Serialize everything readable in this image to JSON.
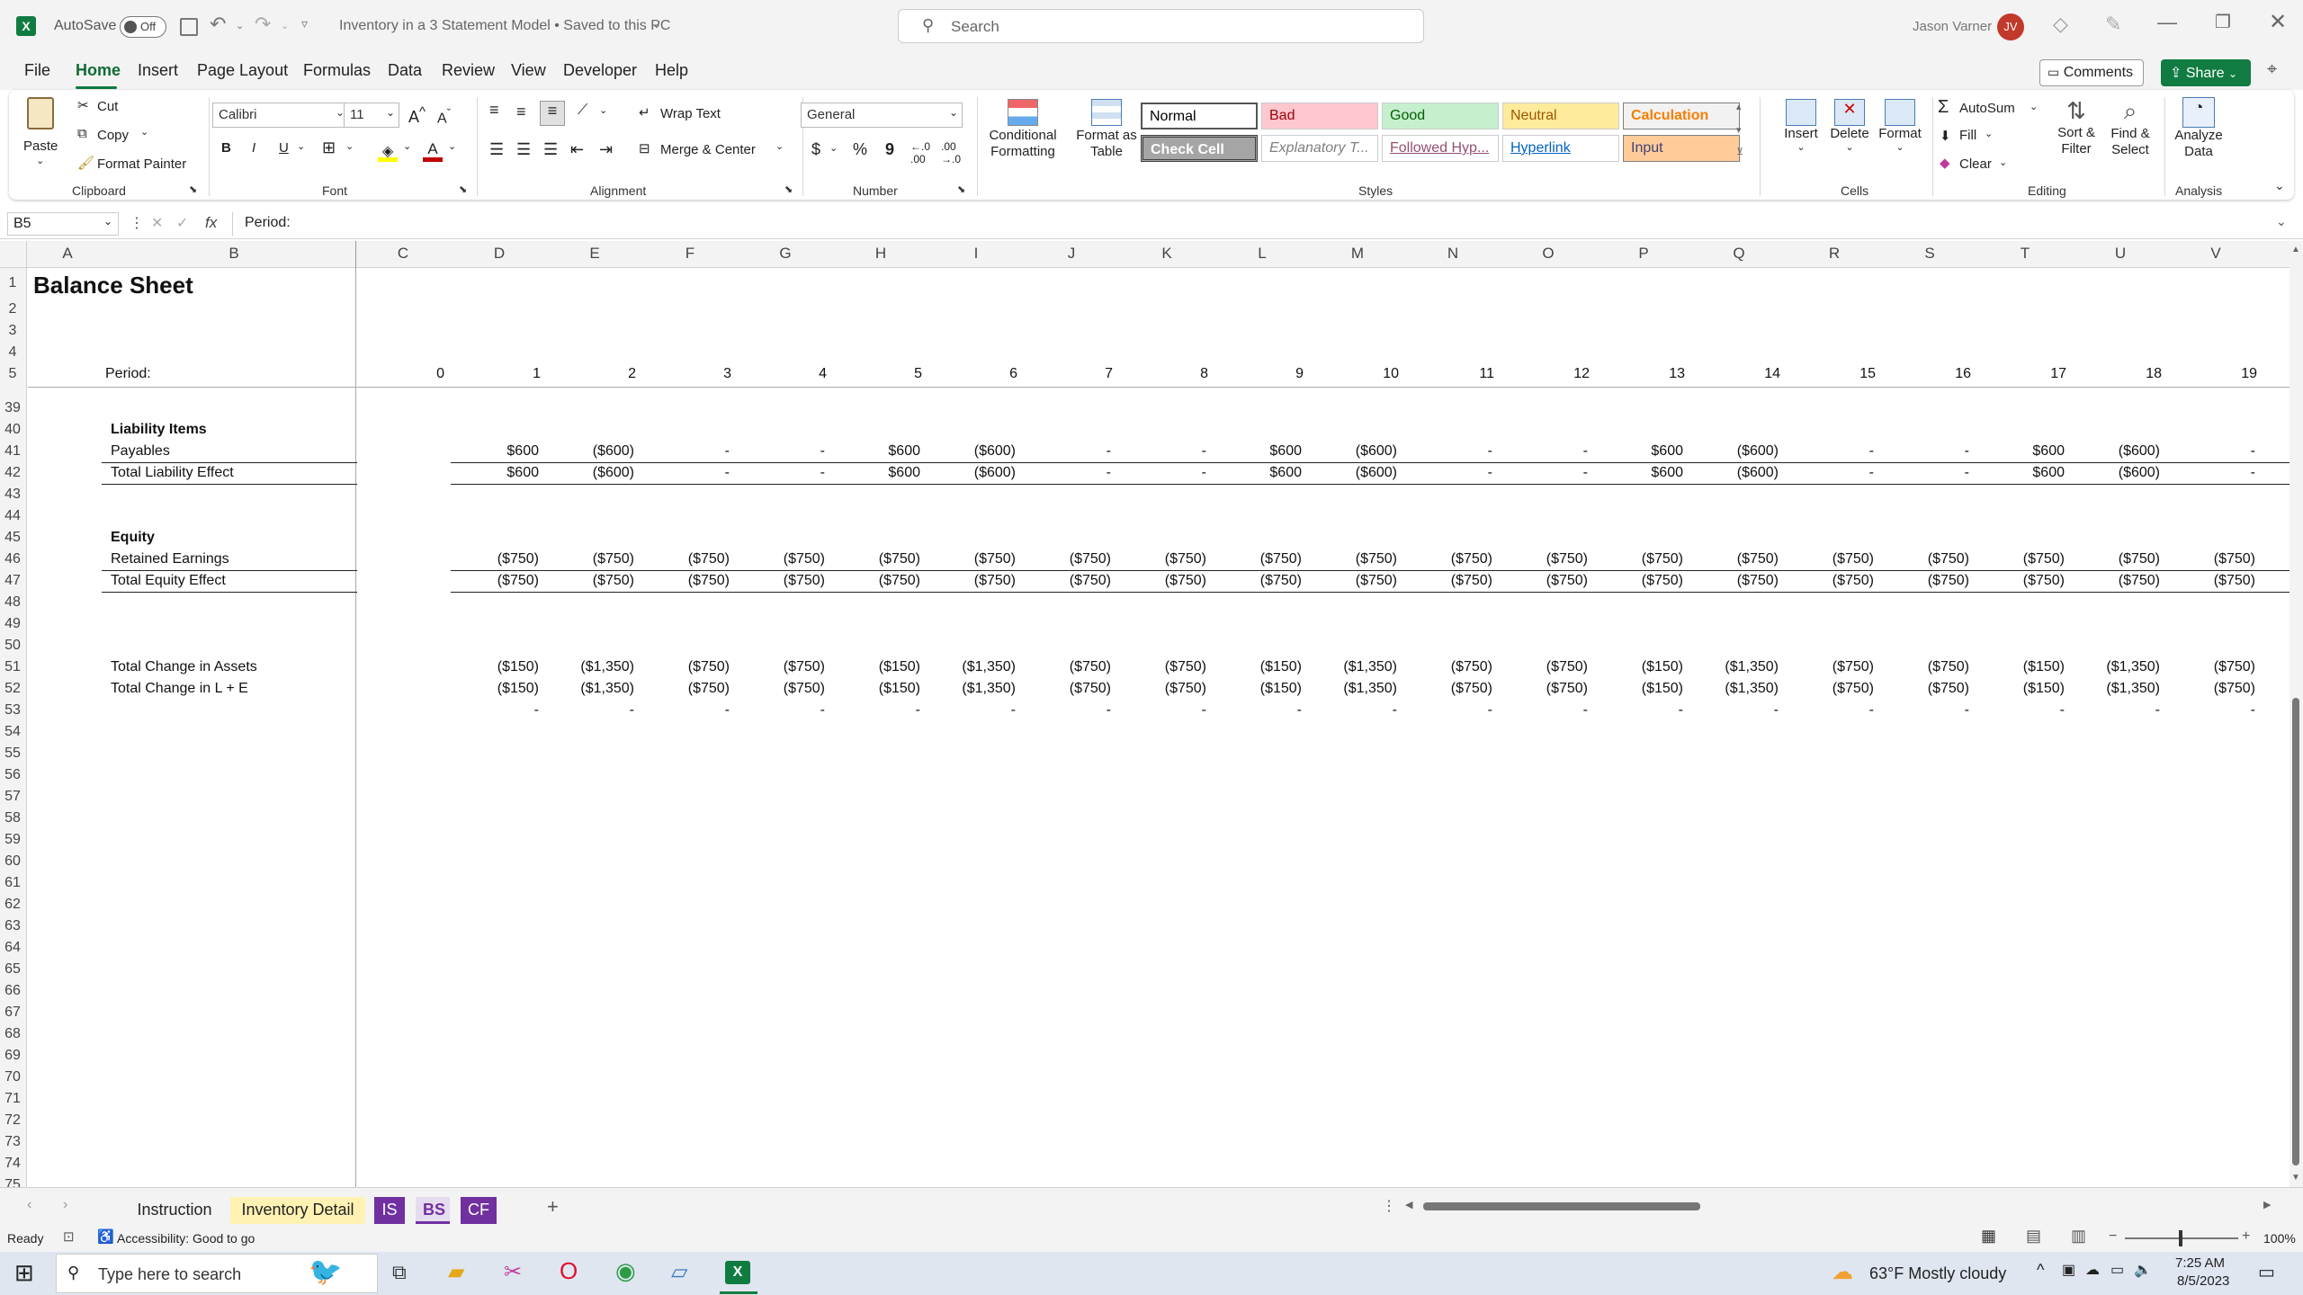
{
  "title_bar": {
    "autosave_label": "AutoSave",
    "autosave_state": "Off",
    "doc_title": "Inventory in a 3 Statement Model • Saved to this PC",
    "search_placeholder": "Search",
    "user_name": "Jason Varner",
    "user_initials": "JV"
  },
  "menu": [
    "File",
    "Home",
    "Insert",
    "Page Layout",
    "Formulas",
    "Data",
    "Review",
    "View",
    "Developer",
    "Help"
  ],
  "menu_right": {
    "comments": "Comments",
    "share": "Share"
  },
  "ribbon": {
    "clipboard": {
      "paste": "Paste",
      "cut": "Cut",
      "copy": "Copy",
      "format_painter": "Format Painter",
      "label": "Clipboard"
    },
    "font": {
      "name": "Calibri",
      "size": "11",
      "bold": "B",
      "italic": "I",
      "underline": "U",
      "label": "Font"
    },
    "alignment": {
      "wrap": "Wrap Text",
      "merge": "Merge & Center",
      "label": "Alignment"
    },
    "number": {
      "format": "General",
      "currency": "$",
      "percent": "%",
      "comma": "9",
      "label": "Number"
    },
    "styles": {
      "conditional": "Conditional Formatting",
      "format_table": "Format as Table",
      "label": "Styles",
      "cells": [
        {
          "name": "Normal",
          "bg": "#ffffff",
          "fg": "#000000"
        },
        {
          "name": "Bad",
          "bg": "#ffc7ce",
          "fg": "#9c0006"
        },
        {
          "name": "Good",
          "bg": "#c6efce",
          "fg": "#006100"
        },
        {
          "name": "Neutral",
          "bg": "#ffeb9c",
          "fg": "#9c5700"
        },
        {
          "name": "Calculation",
          "bg": "#f2f2f2",
          "fg": "#fa7d00"
        },
        {
          "name": "Check Cell",
          "bg": "#a5a5a5",
          "fg": "#ffffff"
        },
        {
          "name": "Explanatory T...",
          "bg": "#ffffff",
          "fg": "#7f7f7f"
        },
        {
          "name": "Followed Hyp...",
          "bg": "#ffffff",
          "fg": "#954f72"
        },
        {
          "name": "Hyperlink",
          "bg": "#ffffff",
          "fg": "#0563c1"
        },
        {
          "name": "Input",
          "bg": "#ffcc99",
          "fg": "#3f3f76"
        }
      ]
    },
    "cells": {
      "insert": "Insert",
      "delete": "Delete",
      "format": "Format",
      "label": "Cells"
    },
    "editing": {
      "autosum": "AutoSum",
      "fill": "Fill",
      "clear": "Clear",
      "sort": "Sort & Filter",
      "find": "Find & Select",
      "label": "Editing"
    },
    "analysis": {
      "analyze": "Analyze Data",
      "label": "Analysis"
    }
  },
  "formula_bar": {
    "name_box": "B5",
    "fx": "fx",
    "content": "Period:"
  },
  "columns": [
    "A",
    "B",
    "C",
    "D",
    "E",
    "F",
    "G",
    "H",
    "I",
    "J",
    "K",
    "L",
    "M",
    "N",
    "O",
    "P",
    "Q",
    "R",
    "S",
    "T",
    "U",
    "V"
  ],
  "rows": [
    "1",
    "2",
    "3",
    "4",
    "5",
    "39",
    "40",
    "41",
    "42",
    "43",
    "44",
    "45",
    "46",
    "47",
    "48",
    "49",
    "50",
    "51",
    "52",
    "53",
    "54",
    "55",
    "56",
    "57",
    "58",
    "59",
    "60",
    "61",
    "62",
    "63",
    "64",
    "65",
    "66",
    "67",
    "68",
    "69",
    "70",
    "71",
    "72",
    "73",
    "74",
    "75"
  ],
  "sheet": {
    "title": "Balance Sheet",
    "period_label": "Period:",
    "periods": [
      "0",
      "1",
      "2",
      "3",
      "4",
      "5",
      "6",
      "7",
      "8",
      "9",
      "10",
      "11",
      "12",
      "13",
      "14",
      "15",
      "16",
      "17",
      "18",
      "19"
    ],
    "liability_items": "Liability Items",
    "payables_label": "Payables",
    "payables": [
      "$600",
      "($600)",
      "-",
      "-",
      "$600",
      "($600)",
      "-",
      "-",
      "$600",
      "($600)",
      "-",
      "-",
      "$600",
      "($600)",
      "-",
      "-",
      "$600",
      "($600)",
      "-"
    ],
    "total_liability_label": "Total Liability Effect",
    "total_liability": [
      "$600",
      "($600)",
      "-",
      "-",
      "$600",
      "($600)",
      "-",
      "-",
      "$600",
      "($600)",
      "-",
      "-",
      "$600",
      "($600)",
      "-",
      "-",
      "$600",
      "($600)",
      "-"
    ],
    "equity": "Equity",
    "retained_label": "Retained Earnings",
    "retained": [
      "($750)",
      "($750)",
      "($750)",
      "($750)",
      "($750)",
      "($750)",
      "($750)",
      "($750)",
      "($750)",
      "($750)",
      "($750)",
      "($750)",
      "($750)",
      "($750)",
      "($750)",
      "($750)",
      "($750)",
      "($750)",
      "($750)"
    ],
    "total_equity_label": "Total Equity Effect",
    "total_equity": [
      "($750)",
      "($750)",
      "($750)",
      "($750)",
      "($750)",
      "($750)",
      "($750)",
      "($750)",
      "($750)",
      "($750)",
      "($750)",
      "($750)",
      "($750)",
      "($750)",
      "($750)",
      "($750)",
      "($750)",
      "($750)",
      "($750)"
    ],
    "change_assets_label": "Total Change in Assets",
    "change_assets": [
      "($150)",
      "($1,350)",
      "($750)",
      "($750)",
      "($150)",
      "($1,350)",
      "($750)",
      "($750)",
      "($150)",
      "($1,350)",
      "($750)",
      "($750)",
      "($150)",
      "($1,350)",
      "($750)",
      "($750)",
      "($150)",
      "($1,350)",
      "($750)"
    ],
    "change_le_label": "Total Change in L + E",
    "change_le": [
      "($150)",
      "($1,350)",
      "($750)",
      "($750)",
      "($150)",
      "($1,350)",
      "($750)",
      "($750)",
      "($150)",
      "($1,350)",
      "($750)",
      "($750)",
      "($150)",
      "($1,350)",
      "($750)",
      "($750)",
      "($150)",
      "($1,350)",
      "($750)"
    ],
    "check": [
      "-",
      "-",
      "-",
      "-",
      "-",
      "-",
      "-",
      "-",
      "-",
      "-",
      "-",
      "-",
      "-",
      "-",
      "-",
      "-",
      "-",
      "-",
      "-"
    ]
  },
  "tabs": [
    {
      "name": "Instruction",
      "bg": "#f3f3f3",
      "fg": "#222"
    },
    {
      "name": "Inventory Detail",
      "bg": "#fff2b3",
      "fg": "#222"
    },
    {
      "name": "IS",
      "bg": "#7030a0",
      "fg": "#ffffff"
    },
    {
      "name": "BS",
      "bg": "#e6dcf0",
      "fg": "#7030a0"
    },
    {
      "name": "CF",
      "bg": "#7030a0",
      "fg": "#ffffff"
    }
  ],
  "status": {
    "ready": "Ready",
    "accessibility": "Accessibility: Good to go",
    "zoom": "100%"
  },
  "taskbar": {
    "search_placeholder": "Type here to search",
    "weather": "63°F  Mostly cloudy",
    "time": "7:25 AM",
    "date": "8/5/2023"
  }
}
